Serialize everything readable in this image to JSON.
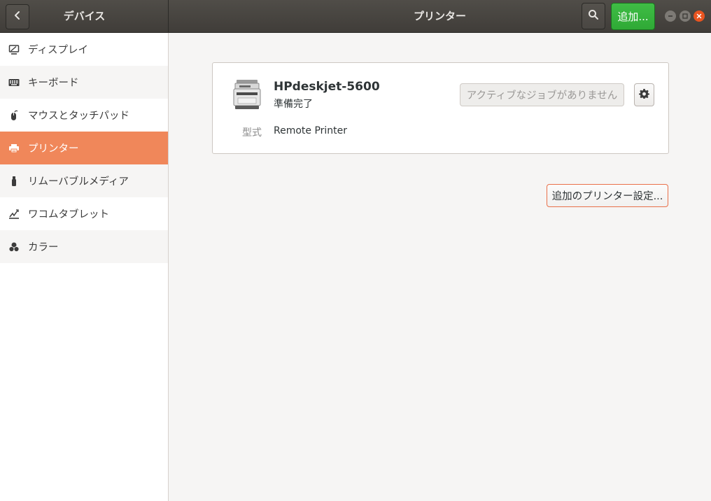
{
  "header": {
    "left_title": "デバイス",
    "title": "プリンター",
    "add_label": "追加..."
  },
  "sidebar": {
    "items": [
      {
        "label": "ディスプレイ",
        "icon": "display-icon"
      },
      {
        "label": "キーボード",
        "icon": "keyboard-icon"
      },
      {
        "label": "マウスとタッチパッド",
        "icon": "mouse-icon"
      },
      {
        "label": "プリンター",
        "icon": "printer-icon",
        "active": true
      },
      {
        "label": "リムーバブルメディア",
        "icon": "usb-drive-icon"
      },
      {
        "label": "ワコムタブレット",
        "icon": "tablet-icon"
      },
      {
        "label": "カラー",
        "icon": "color-icon"
      }
    ]
  },
  "printer": {
    "name": "HPdeskjet-5600",
    "status": "準備完了",
    "model_label": "型式",
    "model_value": "Remote Printer",
    "jobs_label": "アクティブなジョブがありません"
  },
  "actions": {
    "more_settings_label": "追加のプリンター設定..."
  },
  "colors": {
    "accent": "#f0875a",
    "add_button": "#34b13a",
    "close_button": "#e95420",
    "headerbar": "#45423e"
  }
}
